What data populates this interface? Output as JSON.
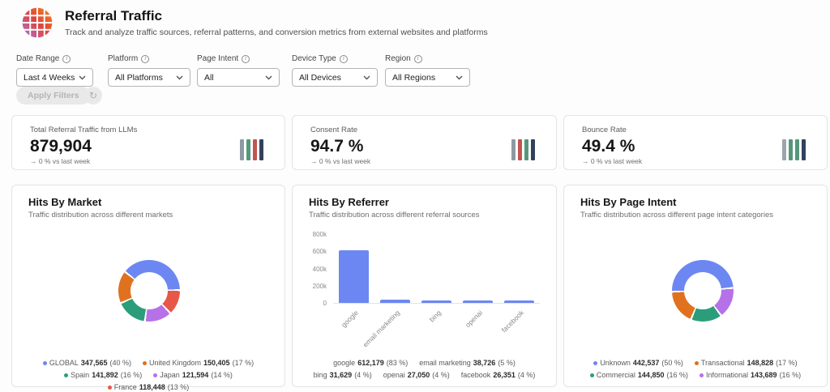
{
  "header": {
    "title": "Referral Traffic",
    "subtitle": "Track and analyze traffic sources, referral patterns, and conversion metrics from external websites and platforms"
  },
  "filters": {
    "items": [
      {
        "label": "Date Range",
        "value": "Last 4 Weeks"
      },
      {
        "label": "Platform",
        "value": "All Platforms"
      },
      {
        "label": "Page Intent",
        "value": "All"
      },
      {
        "label": "Device Type",
        "value": "All Devices"
      },
      {
        "label": "Region",
        "value": "All Regions"
      }
    ],
    "apply_label": "Apply Filters"
  },
  "kpis": [
    {
      "label": "Total Referral Traffic from LLMs",
      "value": "879,904",
      "delta": "→ 0 % vs last week",
      "icon_colors": [
        "#8e9aa3",
        "#55977c",
        "#c2554f",
        "#33415c"
      ]
    },
    {
      "label": "Consent Rate",
      "value": "94.7 %",
      "delta": "→ 0 % vs last week",
      "icon_colors": [
        "#8e9aa3",
        "#c2554f",
        "#55977c",
        "#33415c"
      ]
    },
    {
      "label": "Bounce Rate",
      "value": "49.4 %",
      "delta": "→ 0 % vs last week",
      "icon_colors": [
        "#9aa5ad",
        "#55977c",
        "#55977c",
        "#33415c"
      ]
    }
  ],
  "panels": {
    "market": {
      "title": "Hits By Market",
      "subtitle": "Traffic distribution across different markets"
    },
    "referrer": {
      "title": "Hits By Referrer",
      "subtitle": "Traffic distribution across different referral sources"
    },
    "intent": {
      "title": "Hits By Page Intent",
      "subtitle": "Traffic distribution across different page intent categories"
    }
  },
  "chart_data": [
    {
      "type": "pie",
      "title": "Hits By Market",
      "labels": [
        "GLOBAL",
        "United Kingdom",
        "Spain",
        "Japan",
        "France"
      ],
      "values": [
        347565,
        150405,
        141892,
        121594,
        118448
      ],
      "percents": [
        40,
        17,
        16,
        14,
        13
      ],
      "colors": [
        "#6d87f2",
        "#e0711f",
        "#2b9d7a",
        "#b671e8",
        "#e85648"
      ],
      "start_angle": 310,
      "segments": [
        {
          "color": "#6d87f2",
          "pct": 40
        },
        {
          "color": "#e85648",
          "pct": 13
        },
        {
          "color": "#b671e8",
          "pct": 14
        },
        {
          "color": "#2b9d7a",
          "pct": 16
        },
        {
          "color": "#e0711f",
          "pct": 17
        }
      ],
      "legend": [
        {
          "name": "GLOBAL",
          "value": "347,565",
          "pct": "(40 %)",
          "color": "#6d87f2"
        },
        {
          "name": "United Kingdom",
          "value": "150,405",
          "pct": "(17 %)",
          "color": "#e0711f"
        },
        {
          "name": "Spain",
          "value": "141,892",
          "pct": "(16 %)",
          "color": "#2b9d7a"
        },
        {
          "name": "Japan",
          "value": "121,594",
          "pct": "(14 %)",
          "color": "#b671e8"
        },
        {
          "name": "France",
          "value": "118,448",
          "pct": "(13 %)",
          "color": "#e85648"
        }
      ]
    },
    {
      "type": "bar",
      "title": "Hits By Referrer",
      "categories": [
        "google",
        "email marketing",
        "bing",
        "openai",
        "facebook"
      ],
      "values": [
        612179,
        38726,
        31629,
        27050,
        26351
      ],
      "percents": [
        83,
        5,
        4,
        4,
        4
      ],
      "bar_color": "#6d87f2",
      "ylim": [
        0,
        800000
      ],
      "y_ticks": [
        "800k",
        "600k",
        "400k",
        "200k",
        "0"
      ],
      "legend": [
        {
          "name": "google",
          "value": "612,179",
          "pct": "(83 %)"
        },
        {
          "name": "email marketing",
          "value": "38,726",
          "pct": "(5 %)"
        },
        {
          "name": "bing",
          "value": "31,629",
          "pct": "(4 %)"
        },
        {
          "name": "openai",
          "value": "27,050",
          "pct": "(4 %)"
        },
        {
          "name": "facebook",
          "value": "26,351",
          "pct": "(4 %)"
        }
      ]
    },
    {
      "type": "pie",
      "title": "Hits By Page Intent",
      "labels": [
        "Unknown",
        "Transactional",
        "Commercial",
        "Informational"
      ],
      "values": [
        442537,
        148828,
        144850,
        143689
      ],
      "percents": [
        50,
        17,
        16,
        16
      ],
      "colors": [
        "#6d87f2",
        "#e0711f",
        "#2b9d7a",
        "#b671e8"
      ],
      "start_angle": 270,
      "segments": [
        {
          "color": "#6d87f2",
          "pct": 50
        },
        {
          "color": "#b671e8",
          "pct": 16
        },
        {
          "color": "#2b9d7a",
          "pct": 16
        },
        {
          "color": "#e0711f",
          "pct": 18
        }
      ],
      "legend": [
        {
          "name": "Unknown",
          "value": "442,537",
          "pct": "(50 %)",
          "color": "#6d87f2"
        },
        {
          "name": "Transactional",
          "value": "148,828",
          "pct": "(17 %)",
          "color": "#e0711f"
        },
        {
          "name": "Commercial",
          "value": "144,850",
          "pct": "(16 %)",
          "color": "#2b9d7a"
        },
        {
          "name": "Informational",
          "value": "143,689",
          "pct": "(16 %)",
          "color": "#b671e8"
        }
      ]
    }
  ]
}
